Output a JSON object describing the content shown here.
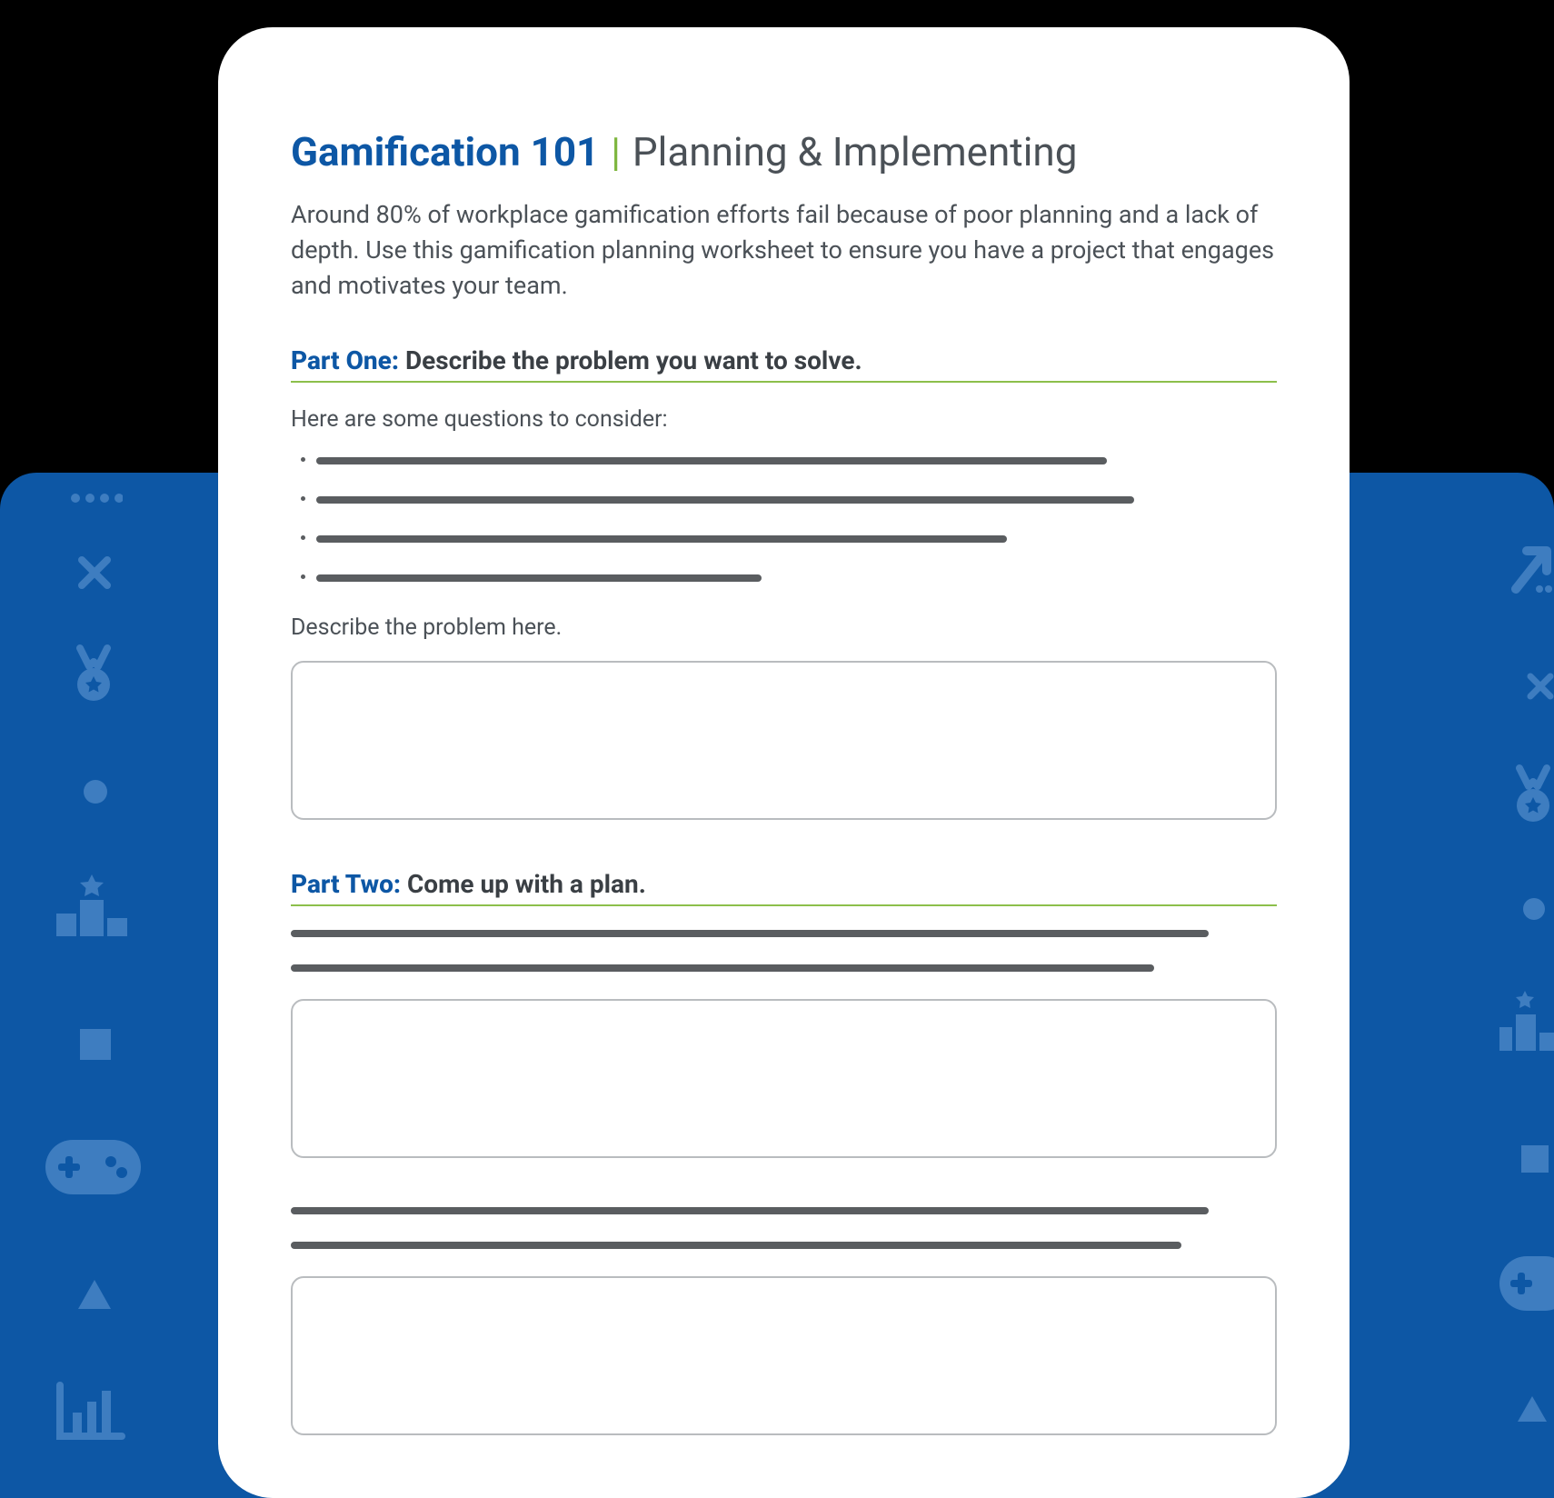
{
  "title": {
    "main": "Gamification 101",
    "separator": "|",
    "sub": "Planning & Implementing"
  },
  "intro": "Around 80% of workplace gamification efforts fail because of poor planning and a lack of depth. Use this gamification planning worksheet to ensure you have a project that engages and motivates your team.",
  "parts": {
    "one": {
      "label": "Part One:",
      "heading": "Describe the problem you want to solve.",
      "consider_intro": "Here are some questions to consider:",
      "field_label": "Describe the problem here."
    },
    "two": {
      "label": "Part Two:",
      "heading": "Come up with a plan."
    }
  },
  "colors": {
    "brand_blue": "#0d57a5",
    "accent_green": "#7eb63f",
    "text": "#4b5157",
    "panel_blue": "#0d57a5"
  }
}
